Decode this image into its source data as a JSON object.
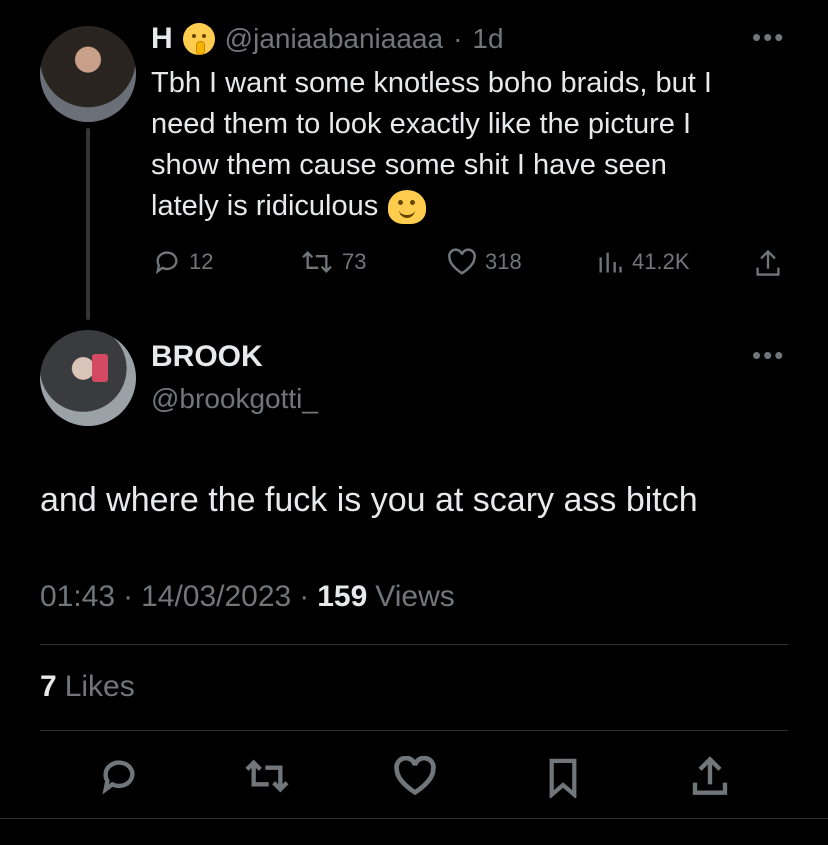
{
  "parent_tweet": {
    "display_name": "H",
    "handle": "@janiaabaniaaaa",
    "separator": "·",
    "time": "1d",
    "text_lines": [
      "Tbh I want some knotless boho braids, but I",
      "need them to look exactly like the picture I",
      "show them cause some shit I have seen",
      "lately is ridiculous"
    ],
    "stats": {
      "replies": "12",
      "retweets": "73",
      "likes": "318",
      "views": "41.2K"
    }
  },
  "reply_tweet": {
    "display_name": "BROOK",
    "handle": "@brookgotti_",
    "text": "and where the fuck is you at scary ass bitch",
    "timestamp_time": "01:43",
    "dot": "·",
    "timestamp_date": "14/03/2023",
    "views_count": "159",
    "views_label": "Views",
    "likes_count": "7",
    "likes_label": "Likes"
  },
  "icons": {
    "reply": "speech-bubble-icon",
    "retweet": "retweet-icon",
    "like": "heart-icon",
    "views": "bar-chart-icon",
    "share": "share-icon",
    "bookmark": "bookmark-icon",
    "more": "more-dots-icon"
  },
  "colors": {
    "background": "#000000",
    "text": "#e7e9ea",
    "muted": "#71767b",
    "divider": "#2f3336",
    "emoji": "#ffcc4d"
  }
}
